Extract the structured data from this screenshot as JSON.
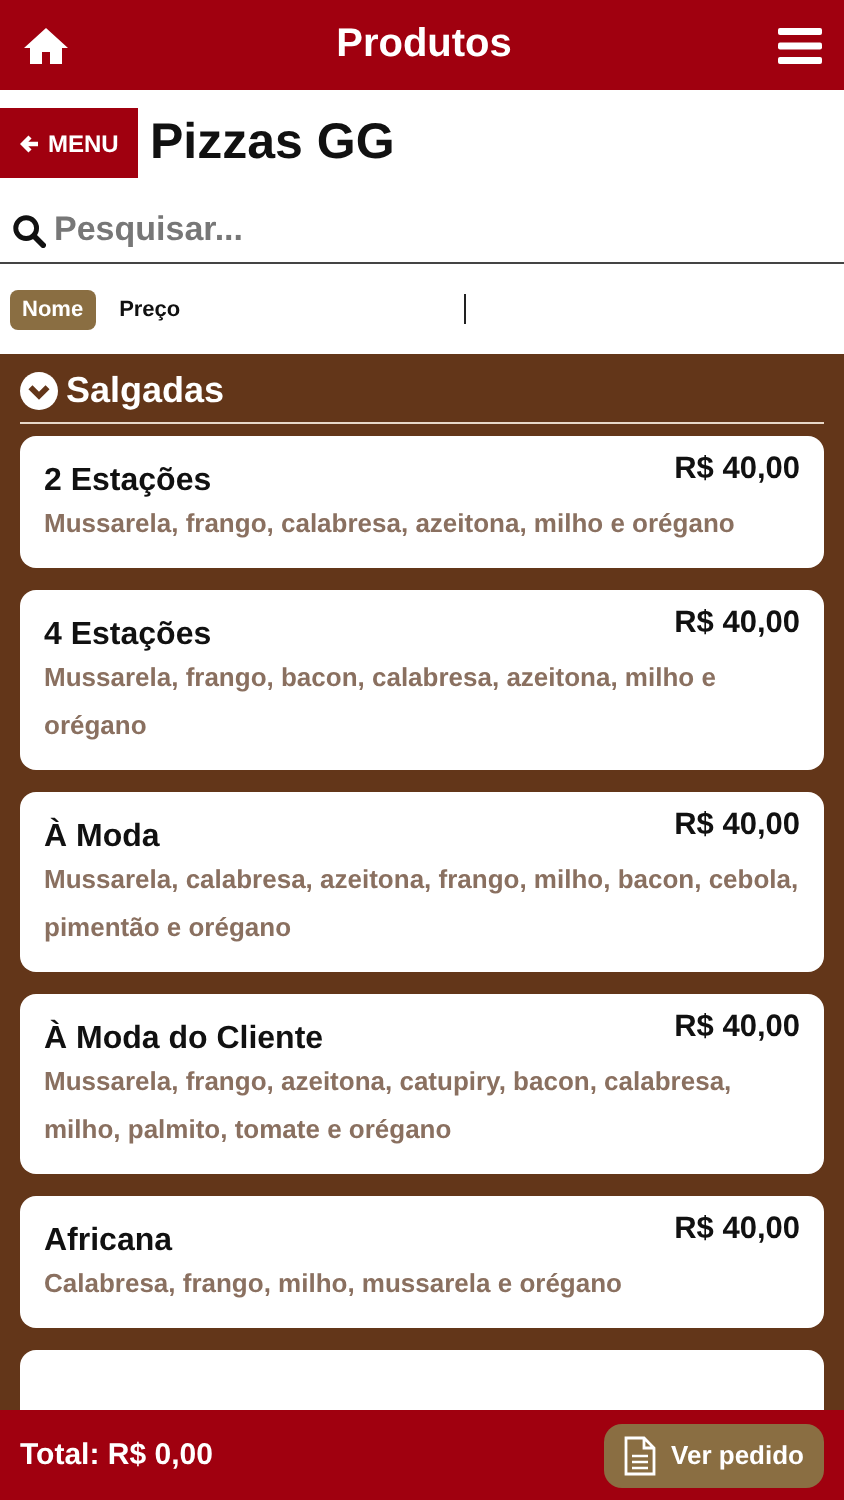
{
  "header": {
    "title": "Produtos"
  },
  "back_button": {
    "label": "MENU"
  },
  "page_title": "Pizzas GG",
  "search": {
    "placeholder": "Pesquisar..."
  },
  "sort_options": [
    {
      "label": "Nome",
      "selected": true
    },
    {
      "label": "Preço",
      "selected": false
    }
  ],
  "section": {
    "title": "Salgadas",
    "expanded": true
  },
  "products": [
    {
      "name": "2 Estações",
      "price": "R$ 40,00",
      "description": "Mussarela, frango, calabresa, azeitona, milho e orégano"
    },
    {
      "name": "4 Estações",
      "price": "R$ 40,00",
      "description": "Mussarela, frango, bacon, calabresa, azeitona, milho e orégano"
    },
    {
      "name": "À Moda",
      "price": "R$ 40,00",
      "description": "Mussarela, calabresa, azeitona, frango, milho, bacon, cebola, pimentão e orégano"
    },
    {
      "name": "À Moda do Cliente",
      "price": "R$ 40,00",
      "description": "Mussarela, frango, azeitona, catupiry, bacon, calabresa, milho, palmito, tomate e orégano"
    },
    {
      "name": "Africana",
      "price": "R$ 40,00",
      "description": "Calabresa, frango, milho, mussarela e orégano"
    }
  ],
  "footer": {
    "total": "Total: R$ 0,00",
    "order_button": "Ver pedido"
  }
}
